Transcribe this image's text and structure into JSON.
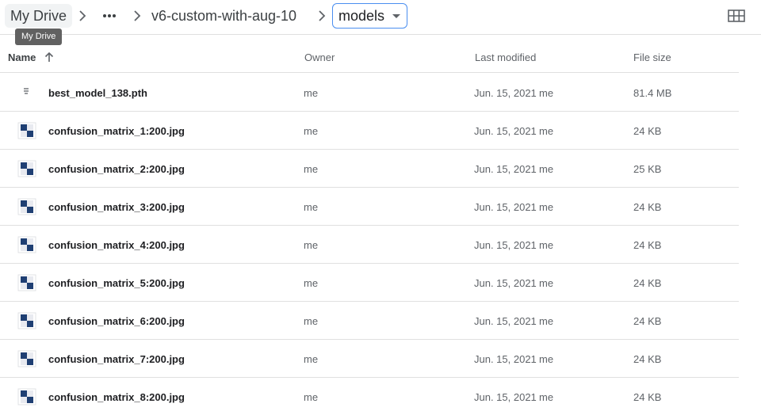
{
  "breadcrumb": {
    "root": "My Drive",
    "middle": "v6-custom-with-aug-10",
    "current": "models"
  },
  "tooltip": "My Drive",
  "columns": {
    "name": "Name",
    "owner": "Owner",
    "last_modified": "Last modified",
    "file_size": "File size"
  },
  "files": [
    {
      "name": "best_model_138.pth",
      "icon": "generic-file-icon",
      "owner": "me",
      "modified": "Jun. 15, 2021",
      "modified_by": "me",
      "size": "81.4 MB"
    },
    {
      "name": "confusion_matrix_1:200.jpg",
      "icon": "image-thumbnail-icon",
      "owner": "me",
      "modified": "Jun. 15, 2021",
      "modified_by": "me",
      "size": "24 KB"
    },
    {
      "name": "confusion_matrix_2:200.jpg",
      "icon": "image-thumbnail-icon",
      "owner": "me",
      "modified": "Jun. 15, 2021",
      "modified_by": "me",
      "size": "25 KB"
    },
    {
      "name": "confusion_matrix_3:200.jpg",
      "icon": "image-thumbnail-icon",
      "owner": "me",
      "modified": "Jun. 15, 2021",
      "modified_by": "me",
      "size": "24 KB"
    },
    {
      "name": "confusion_matrix_4:200.jpg",
      "icon": "image-thumbnail-icon",
      "owner": "me",
      "modified": "Jun. 15, 2021",
      "modified_by": "me",
      "size": "24 KB"
    },
    {
      "name": "confusion_matrix_5:200.jpg",
      "icon": "image-thumbnail-icon",
      "owner": "me",
      "modified": "Jun. 15, 2021",
      "modified_by": "me",
      "size": "24 KB"
    },
    {
      "name": "confusion_matrix_6:200.jpg",
      "icon": "image-thumbnail-icon",
      "owner": "me",
      "modified": "Jun. 15, 2021",
      "modified_by": "me",
      "size": "24 KB"
    },
    {
      "name": "confusion_matrix_7:200.jpg",
      "icon": "image-thumbnail-icon",
      "owner": "me",
      "modified": "Jun. 15, 2021",
      "modified_by": "me",
      "size": "24 KB"
    },
    {
      "name": "confusion_matrix_8:200.jpg",
      "icon": "image-thumbnail-icon",
      "owner": "me",
      "modified": "Jun. 15, 2021",
      "modified_by": "me",
      "size": "24 KB"
    }
  ],
  "colors": {
    "accent": "#4a8ef0",
    "thumbnail": "#1f3f73"
  }
}
